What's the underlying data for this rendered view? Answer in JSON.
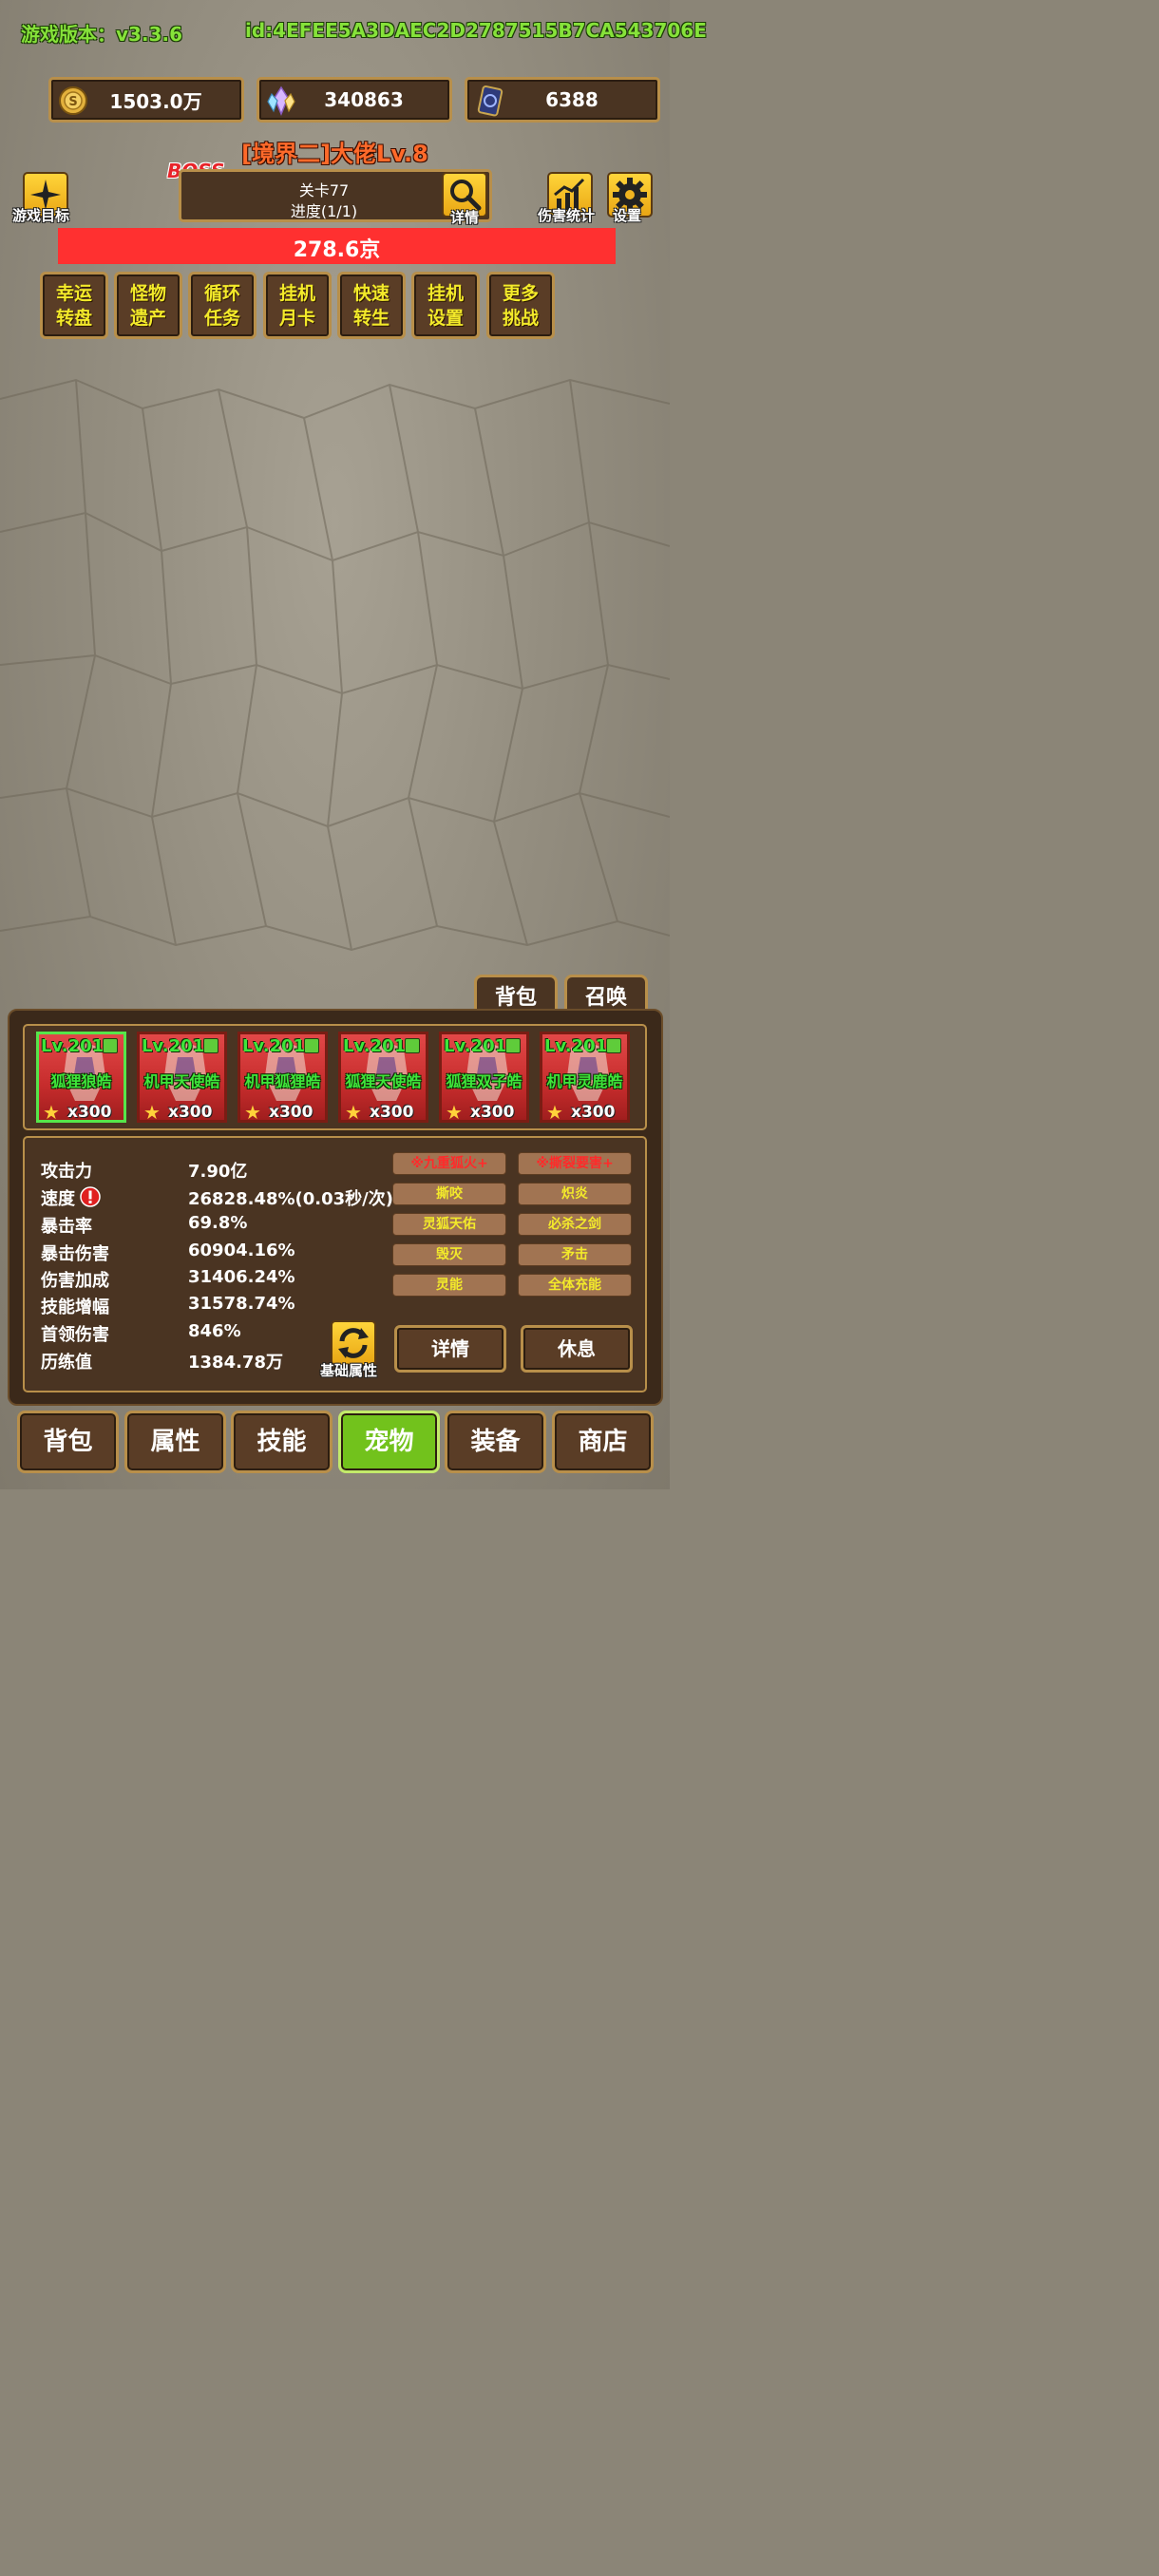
{
  "header": {
    "version": "游戏版本：v3.3.6",
    "player_id": "id:4EFEE5A3DAEC2D2787515B7CA543706E"
  },
  "resources": [
    {
      "icon": "gold-coin-icon",
      "value": "1503.0万"
    },
    {
      "icon": "crystal-icon",
      "value": "340863"
    },
    {
      "icon": "card-icon",
      "value": "6388"
    }
  ],
  "boss": {
    "title": "[境界二]大佬Lv.8",
    "tag": "BOSS",
    "stage": "关卡77",
    "progress": "进度(1/1)",
    "hp": "278.6京",
    "hp_fraction": 1.0
  },
  "top_buttons": {
    "goal": "游戏目标",
    "detail": "详情",
    "damage_stats": "伤害统计",
    "settings": "设置"
  },
  "features": [
    {
      "l1": "幸运",
      "l2": "转盘"
    },
    {
      "l1": "怪物",
      "l2": "遗产"
    },
    {
      "l1": "循环",
      "l2": "任务"
    },
    {
      "l1": "挂机",
      "l2": "月卡"
    },
    {
      "l1": "快速",
      "l2": "转生"
    },
    {
      "l1": "挂机",
      "l2": "设置"
    },
    {
      "l1": "更多",
      "l2": "挑战"
    }
  ],
  "panel_tabs": {
    "bag": "背包",
    "summon": "召唤"
  },
  "pets": [
    {
      "level": "Lv.201",
      "name": "狐狸狼皓",
      "count": "x300"
    },
    {
      "level": "Lv.201",
      "name": "机甲天使皓",
      "count": "x300"
    },
    {
      "level": "Lv.201",
      "name": "机甲狐狸皓",
      "count": "x300"
    },
    {
      "level": "Lv.201",
      "name": "狐狸天使皓",
      "count": "x300"
    },
    {
      "level": "Lv.201",
      "name": "狐狸双子皓",
      "count": "x300"
    },
    {
      "level": "Lv.201",
      "name": "机甲灵鹿皓",
      "count": "x300"
    }
  ],
  "stats": [
    {
      "label": "攻击力",
      "value": "7.90亿"
    },
    {
      "label": "速度",
      "value": "26828.48%(0.03秒/次)"
    },
    {
      "label": "暴击率",
      "value": "69.8%"
    },
    {
      "label": "暴击伤害",
      "value": "60904.16%"
    },
    {
      "label": "伤害加成",
      "value": "31406.24%"
    },
    {
      "label": "技能增幅",
      "value": "31578.74%"
    },
    {
      "label": "首领伤害",
      "value": "846%"
    },
    {
      "label": "历练值",
      "value": "1384.78万"
    }
  ],
  "skills": [
    "※九重狐火+",
    "※撕裂要害+",
    "撕咬",
    "炽炎",
    "灵狐天佑",
    "必杀之剑",
    "毁灭",
    "矛击",
    "灵能",
    "全体充能"
  ],
  "actions": {
    "base_attr": "基础属性",
    "detail": "详情",
    "rest": "休息"
  },
  "bottom_nav": [
    "背包",
    "属性",
    "技能",
    "宠物",
    "装备",
    "商店"
  ],
  "colors": {
    "accent_green": "#72c21c",
    "hp_red": "#ff3030",
    "frame_gold": "#b88f4a"
  }
}
